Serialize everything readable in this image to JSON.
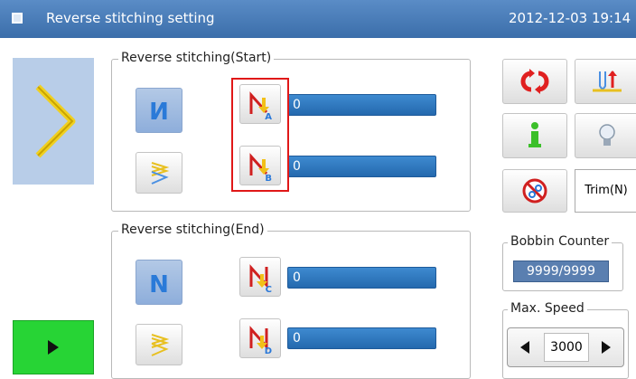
{
  "window": {
    "title": "Reverse stitching setting",
    "datetime": "2012-12-03 19:14"
  },
  "start_group": {
    "legend": "Reverse stitching(Start)",
    "field_a": {
      "letter": "A",
      "value": "0"
    },
    "field_b": {
      "letter": "B",
      "value": "0"
    }
  },
  "end_group": {
    "legend": "Reverse stitching(End)",
    "field_c": {
      "letter": "C",
      "value": "0"
    },
    "field_d": {
      "letter": "D",
      "value": "0"
    }
  },
  "right_panel": {
    "trim_label": "Trim(N)",
    "bobbin_title": "Bobbin Counter",
    "bobbin_value": "9999/9999",
    "speed_title": "Max. Speed",
    "speed_value": "3000"
  },
  "colors": {
    "titlebar": "#3b6eaa",
    "field": "#2a70b6",
    "play": "#27d435",
    "highlight": "#e01818"
  },
  "icons": [
    "window-icon",
    "zigzag-preview-icon",
    "reverse-n-icon",
    "reverse-a-icon",
    "reverse-b-icon",
    "zigzag-toggle-icon",
    "n-pattern-icon",
    "reverse-c-icon",
    "reverse-d-icon",
    "refresh-icon",
    "needle-icon",
    "info-icon",
    "bulb-icon",
    "no-trim-icon",
    "play-icon",
    "left-arrow-icon",
    "right-arrow-icon"
  ]
}
